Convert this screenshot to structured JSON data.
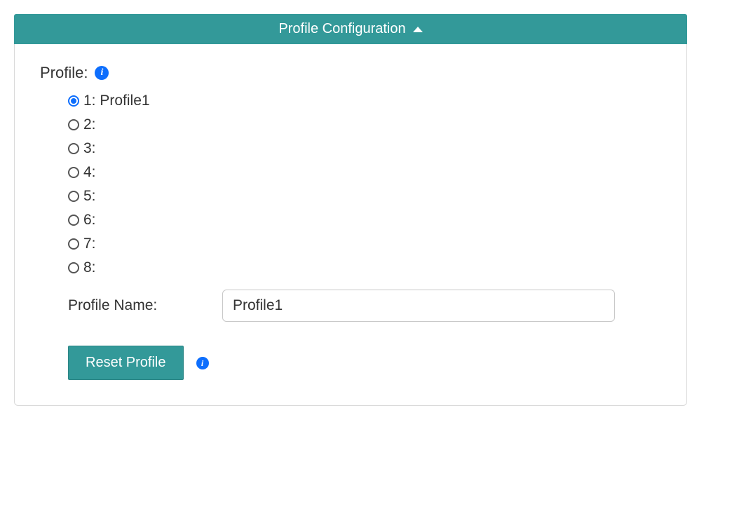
{
  "panel": {
    "title": "Profile Configuration"
  },
  "profile": {
    "section_label": "Profile:",
    "selected_index": 0,
    "options": [
      {
        "label": "1: Profile1"
      },
      {
        "label": "2:"
      },
      {
        "label": "3:"
      },
      {
        "label": "4:"
      },
      {
        "label": "5:"
      },
      {
        "label": "6:"
      },
      {
        "label": "7:"
      },
      {
        "label": "8:"
      }
    ],
    "name_label": "Profile Name:",
    "name_value": "Profile1",
    "reset_label": "Reset Profile"
  }
}
